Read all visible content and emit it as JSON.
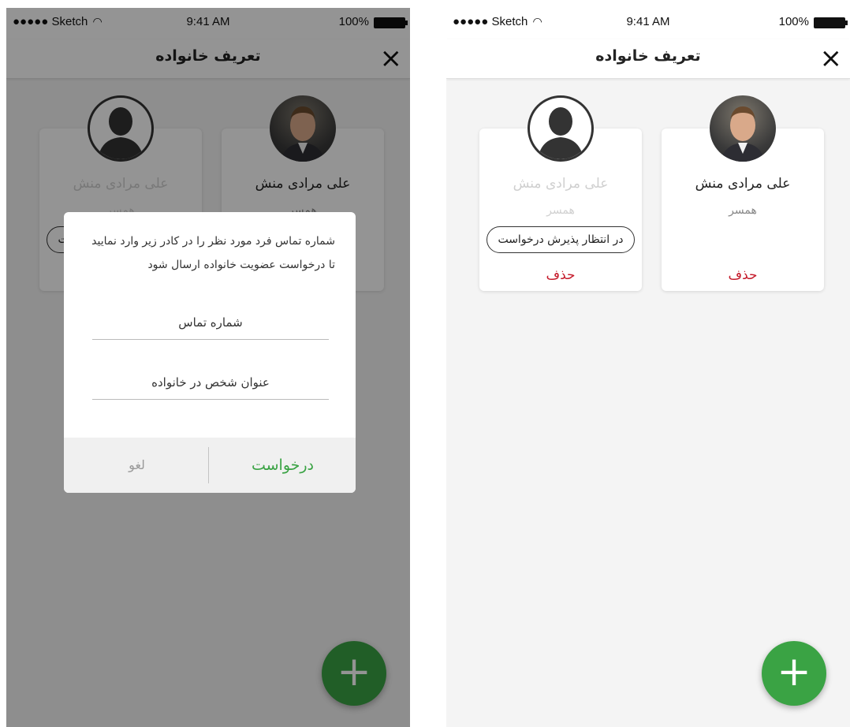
{
  "status_bar": {
    "carrier": "●●●●● Sketch",
    "time": "9:41 AM",
    "battery": "100%"
  },
  "nav": {
    "title": "تعریف خانواده",
    "close_icon": "close-icon"
  },
  "members": [
    {
      "name": "علی مرادی منش",
      "role": "همسر",
      "delete_label": "حذف",
      "avatar": "person-photo"
    },
    {
      "name": "علی مرادی منش",
      "role": "همسر",
      "status": "در انتظار پذیرش درخواست",
      "delete_label": "حذف",
      "avatar": "person-silhouette-icon"
    }
  ],
  "dialog": {
    "message": "شماره تماس فرد مورد نظر را در کادر زیر وارد نمایید تا درخواست عضویت خانواده ارسال شود",
    "phone_placeholder": "شماره تماس",
    "family_title_placeholder": "عنوان شخص در خانواده",
    "request_label": "درخواست",
    "cancel_label": "لغو"
  },
  "fab": {
    "label": "+",
    "icon": "plus-icon"
  },
  "colors": {
    "accent_green": "#3aa344",
    "delete_red": "#c51a2a",
    "overlay": "rgba(0,0,0,0.42)"
  }
}
